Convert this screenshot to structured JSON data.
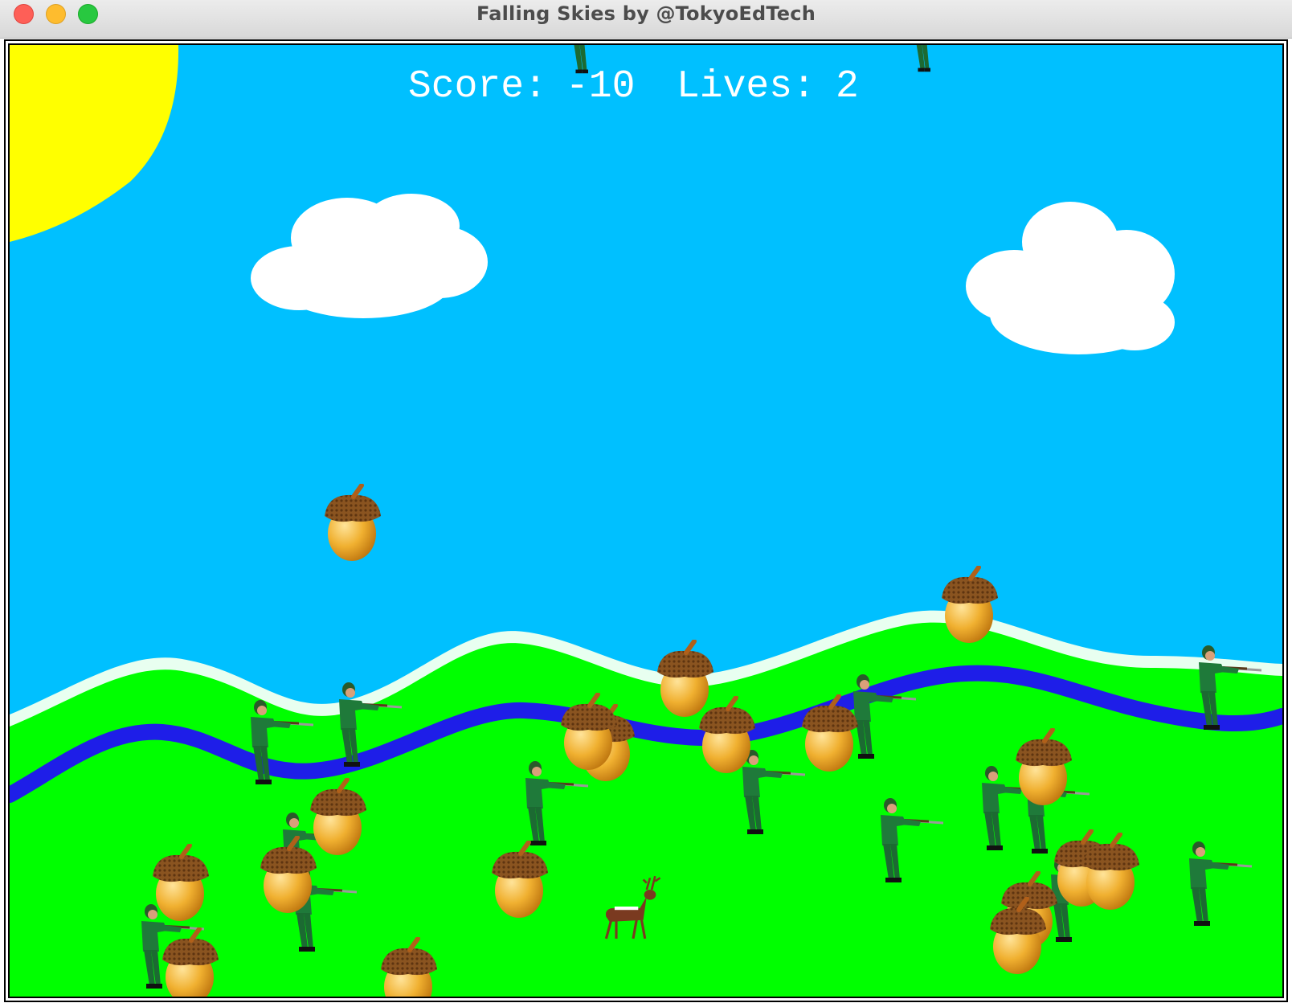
{
  "window": {
    "title": "Falling Skies by @TokyoEdTech"
  },
  "hud": {
    "score_label": "Score:",
    "score_value": "-10",
    "lives_label": "Lives:",
    "lives_value": "2"
  },
  "colors": {
    "sky": "#00c0ff",
    "sun": "#ffff00",
    "grass": "#00ff00",
    "river": "#1e1ee8",
    "cloud": "#ffffff",
    "acorn_nut": "#e8a020",
    "acorn_cap": "#7a4a1a",
    "hunter_uniform": "#1e7a3a",
    "deer": "#7a3a20"
  },
  "sprites": {
    "player": "deer-icon",
    "good_item": "acorn-icon",
    "bad_item": "hunter-icon"
  }
}
